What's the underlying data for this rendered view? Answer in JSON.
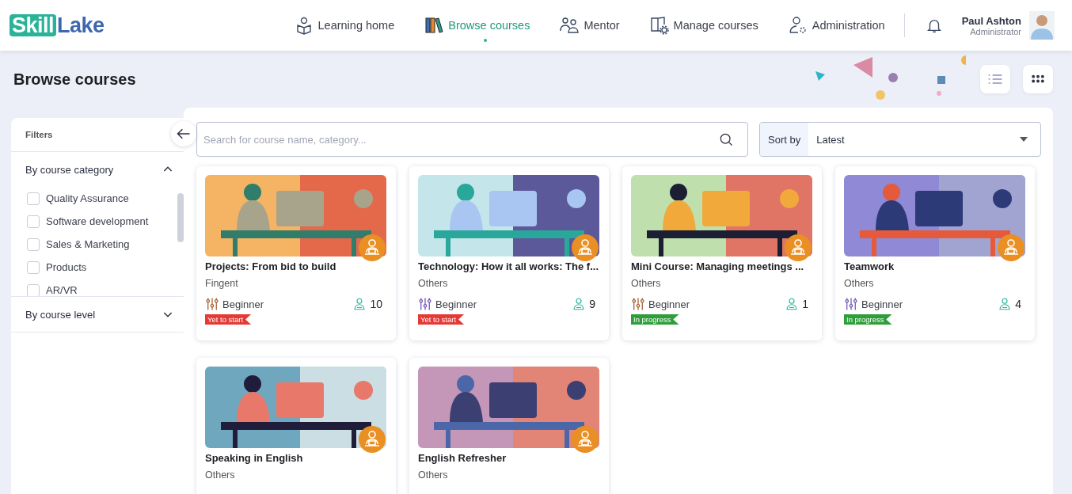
{
  "logo": {
    "part_1": "Skill",
    "part_2": "Lake"
  },
  "nav": [
    {
      "label": "Learning home",
      "selected": false
    },
    {
      "label": "Browse courses",
      "selected": true
    },
    {
      "label": "Mentor",
      "selected": false
    },
    {
      "label": "Manage courses",
      "selected": false
    },
    {
      "label": "Administration",
      "selected": false
    }
  ],
  "user": {
    "name": "Paul Ashton",
    "role": "Administrator"
  },
  "page_title": "Browse courses",
  "filters": {
    "title": "Filters",
    "sections": [
      {
        "title": "By course category",
        "expanded": true,
        "options": [
          {
            "label": "Quality Assurance",
            "checked": false
          },
          {
            "label": "Software development",
            "checked": false
          },
          {
            "label": "Sales & Marketing",
            "checked": false
          },
          {
            "label": "Products",
            "checked": false
          },
          {
            "label": "AR/VR",
            "checked": false
          }
        ]
      },
      {
        "title": "By course level",
        "expanded": false
      }
    ]
  },
  "search": {
    "placeholder": "Search for course name, category..."
  },
  "sort": {
    "label": "Sort by",
    "value": "Latest"
  },
  "courses": [
    {
      "title": "Projects: From bid to build",
      "category": "Fingent",
      "level": "Beginner",
      "learners": "10",
      "status": {
        "kind": "not-started",
        "label": "Yet to start"
      }
    },
    {
      "title": "Technology: How it all works: The f...",
      "category": "Others",
      "level": "Beginner",
      "learners": "9",
      "status": {
        "kind": "not-started",
        "label": "Yet to start"
      }
    },
    {
      "title": "Mini Course: Managing meetings ...",
      "category": "Others",
      "level": "Beginner",
      "learners": "1",
      "status": {
        "kind": "in-progress",
        "label": "In progress"
      }
    },
    {
      "title": "Teamwork",
      "category": "Others",
      "level": "Beginner",
      "learners": "4",
      "status": {
        "kind": "in-progress",
        "label": "In progress"
      }
    },
    {
      "title": "Speaking in English",
      "category": "Others"
    },
    {
      "title": "English Refresher",
      "category": "Others"
    }
  ]
}
